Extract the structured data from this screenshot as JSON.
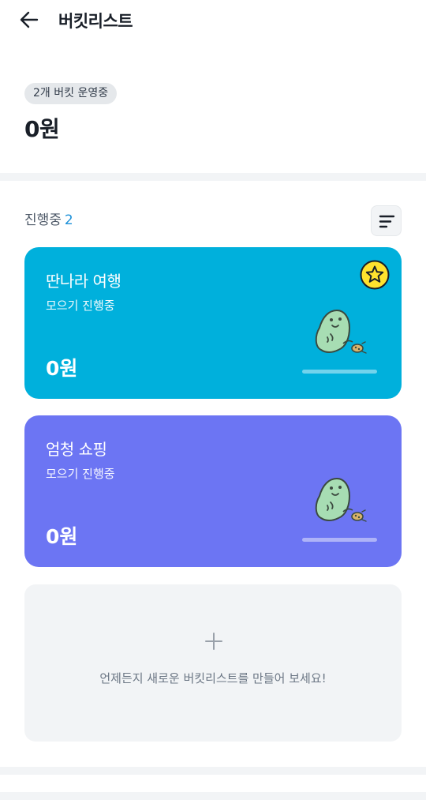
{
  "header": {
    "title": "버킷리스트",
    "back_icon": "arrow-left-icon"
  },
  "summary": {
    "badge": "2개 버킷 운영중",
    "total": "0원"
  },
  "section": {
    "label": "진행중",
    "count": "2",
    "sort_icon": "sort-lines-icon"
  },
  "buckets": [
    {
      "title": "딴나라 여행",
      "status": "모으기 진행중",
      "amount": "0원",
      "color": "#00b0dc",
      "starred": true,
      "progress": 0
    },
    {
      "title": "엄청 쇼핑",
      "status": "모으기 진행중",
      "amount": "0원",
      "color": "#6c75f3",
      "starred": false,
      "progress": 0
    }
  ],
  "add_card": {
    "text": "언제든지 새로운 버킷리스트를 만들어 보세요!",
    "icon": "plus-icon"
  },
  "colors": {
    "accent": "#1b90d8",
    "star": "#ffe22e"
  }
}
